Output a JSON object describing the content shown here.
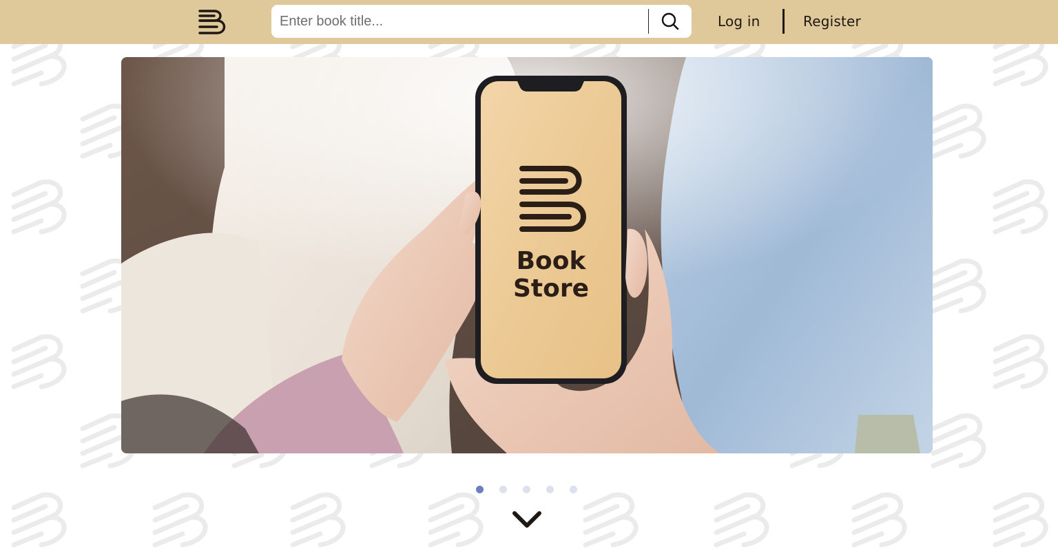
{
  "header": {
    "logo_name": "book-store-logo",
    "search": {
      "placeholder": "Enter book title...",
      "value": "",
      "button_icon": "search-icon"
    },
    "login_label": "Log in",
    "register_label": "Register"
  },
  "hero": {
    "slide_text_line1": "Book",
    "slide_text_line2": "Store",
    "slide_count": 5,
    "active_slide": 1
  },
  "scroll_icon": "chevron-down-icon",
  "colors": {
    "header_bg": "#dfc99b",
    "brand_dark": "#1f1712",
    "active_dot": "#6e7fbf",
    "inactive_dot": "#dde1ef"
  }
}
